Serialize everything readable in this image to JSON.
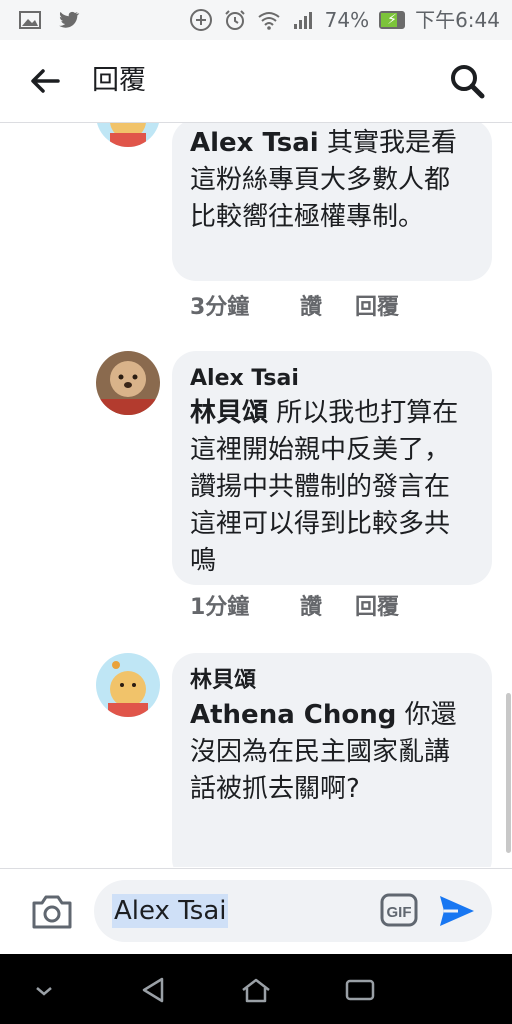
{
  "status_bar": {
    "battery_percent": "74%",
    "battery_level": 0.74,
    "time": "下午6:44",
    "icons": [
      "gallery-icon",
      "twitter-icon",
      "add-circle-icon",
      "alarm-icon",
      "wifi-icon",
      "signal-icon",
      "battery-icon"
    ]
  },
  "header": {
    "title": "回覆",
    "back_icon": "arrow-left-icon",
    "search_icon": "search-icon"
  },
  "comments": [
    {
      "author": "",
      "mention": "Alex Tsai",
      "text": " 其實我是看這粉絲專頁大多數人都比較嚮往極權專制。",
      "time": "3分鐘",
      "like": "讚",
      "reply": "回覆"
    },
    {
      "author": "Alex Tsai",
      "mention": "林貝頌",
      "text": " 所以我也打算在這裡開始親中反美了，讚揚中共體制的發言在這裡可以得到比較多共鳴",
      "time": "1分鐘",
      "like": "讚",
      "reply": "回覆"
    },
    {
      "author": "林貝頌",
      "mention": "Athena Chong",
      "text": " 你還沒因為在民主國家亂講話被抓去關啊?",
      "time": "",
      "like": "",
      "reply": ""
    }
  ],
  "composer": {
    "value": "Alex Tsai",
    "camera_icon": "camera-icon",
    "gif_label": "GIF",
    "send_icon": "send-icon"
  },
  "nav": {
    "icons": [
      "chevron-down-icon",
      "back-triangle-icon",
      "home-icon",
      "recents-icon"
    ]
  },
  "colors": {
    "bubble": "#f0f2f5",
    "accent": "#1877f2",
    "meta": "#65676b"
  }
}
